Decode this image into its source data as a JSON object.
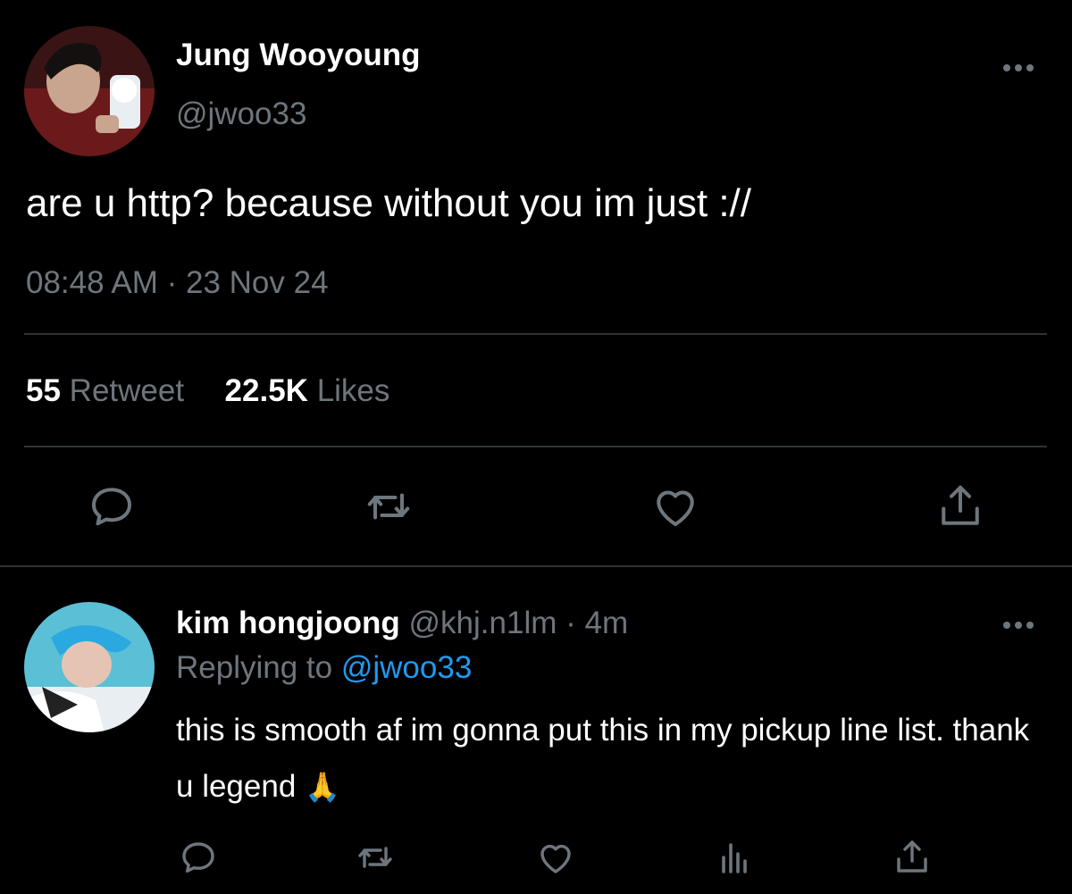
{
  "tweet": {
    "author_name": "Jung Wooyoung",
    "author_handle": "@jwoo33",
    "text": "are u http? because without you im just ://",
    "timestamp": "08:48 AM · 23 Nov 24",
    "retweet_count": "55",
    "retweet_label": "Retweet",
    "like_count": "22.5K",
    "like_label": "Likes"
  },
  "reply": {
    "author_name": "kim hongjoong",
    "author_handle": "@khj.n1lm",
    "separator": " · ",
    "time_ago": "4m",
    "replying_prefix": "Replying to",
    "replying_to": "@jwoo33",
    "text": "this is smooth af im gonna put this in my pickup line list. thank u legend",
    "emoji": "🙏"
  },
  "colors": {
    "background": "#000000",
    "muted": "#6e767d",
    "link": "#1d9bf0",
    "divider": "#2f3336"
  },
  "icons": [
    "more-icon",
    "reply-icon",
    "retweet-icon",
    "like-icon",
    "share-icon",
    "stats-icon"
  ]
}
